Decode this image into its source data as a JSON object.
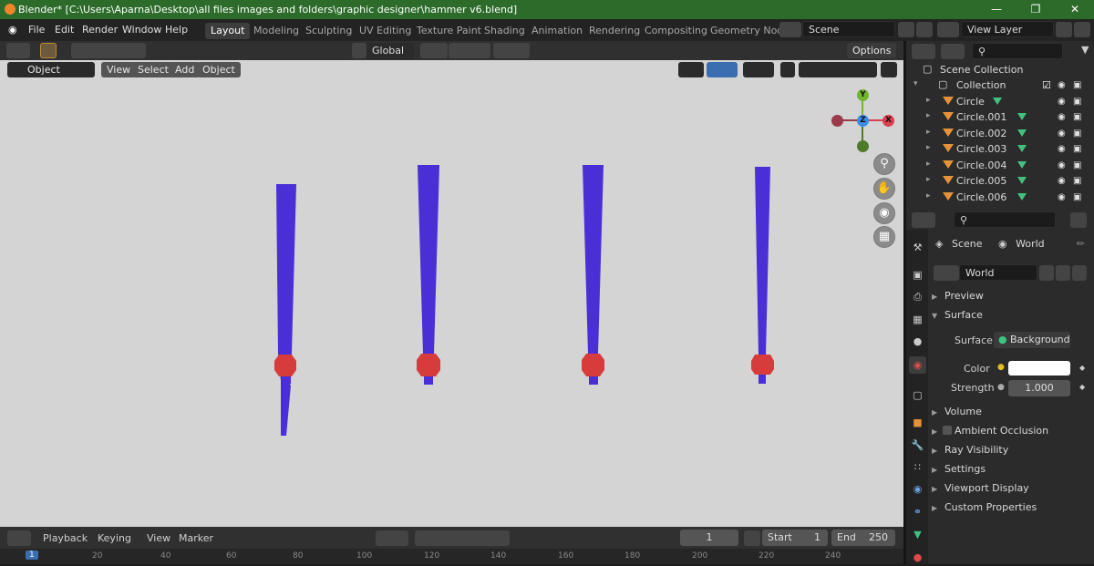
{
  "window": {
    "title": "Blender* [C:\\Users\\Aparna\\Desktop\\all files images and folders\\graphic designer\\hammer v6.blend]",
    "minimize": "—",
    "maximize": "❐",
    "close": "✕"
  },
  "menubar": {
    "items": [
      "File",
      "Edit",
      "Render",
      "Window",
      "Help"
    ],
    "workspaces": [
      "Layout",
      "Modeling",
      "Sculpting",
      "UV Editing",
      "Texture Paint",
      "Shading",
      "Animation",
      "Rendering",
      "Compositing",
      "Geometry Nod"
    ],
    "active_workspace": "Layout",
    "scene": "Scene",
    "view_layer": "View Layer"
  },
  "viewport_header": {
    "transform_orientation": "Global",
    "options": "Options",
    "mode": "Object Mode",
    "menus": [
      "View",
      "Select",
      "Add",
      "Object"
    ]
  },
  "gizmo": {
    "y": "Y",
    "z": "Z",
    "x": "X",
    "colors": {
      "x": "#d9404f",
      "y": "#72b52f",
      "z": "#3a8ee8",
      "neg_x": "#9a3a4a",
      "neg_y": "#4f7a2a"
    }
  },
  "nav_icons": [
    "zoom-icon",
    "hand-pan-icon",
    "camera-icon",
    "grid-perspective-icon"
  ],
  "scene_objects": {
    "shaft_color": "#4a2fd6",
    "head_color": "#d63c3c"
  },
  "timeline": {
    "menus": [
      "Playback",
      "Keying",
      "View",
      "Marker"
    ],
    "current_frame": "1",
    "start_label": "Start",
    "start": "1",
    "end_label": "End",
    "end": "250",
    "ruler": [
      "1",
      "20",
      "40",
      "60",
      "80",
      "100",
      "120",
      "140",
      "160",
      "180",
      "200",
      "220",
      "240"
    ]
  },
  "outliner": {
    "root": "Scene Collection",
    "collection": "Collection",
    "objects": [
      "Circle",
      "Circle.001",
      "Circle.002",
      "Circle.003",
      "Circle.004",
      "Circle.005",
      "Circle.006"
    ]
  },
  "properties": {
    "breadcrumb_scene": "Scene",
    "breadcrumb_world": "World",
    "world_name": "World",
    "panels": {
      "preview": "Preview",
      "surface": "Surface",
      "surface_label": "Surface",
      "surface_value": "Background",
      "color_label": "Color",
      "strength_label": "Strength",
      "strength_value": "1.000",
      "volume": "Volume",
      "ambient_occlusion": "Ambient Occlusion",
      "ray_visibility": "Ray Visibility",
      "settings": "Settings",
      "viewport_display": "Viewport Display",
      "custom_properties": "Custom Properties"
    }
  }
}
